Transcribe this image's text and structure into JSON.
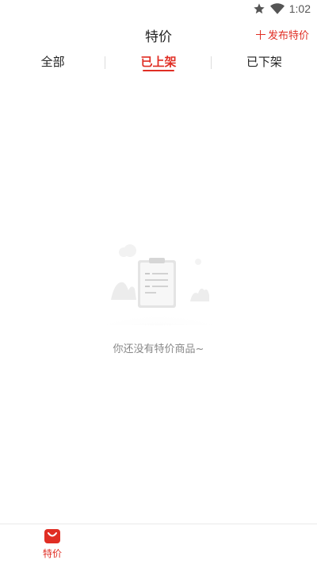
{
  "status_bar": {
    "time": "1:02",
    "icons": [
      "star-icon",
      "wifi-icon"
    ]
  },
  "header": {
    "title": "特价",
    "publish_label": "发布特价"
  },
  "tabs": [
    {
      "label": "全部",
      "active": false
    },
    {
      "label": "已上架",
      "active": true
    },
    {
      "label": "已下架",
      "active": false
    }
  ],
  "empty_state": {
    "message": "你还没有特价商品~"
  },
  "bottom_nav": {
    "items": [
      {
        "label": "特价",
        "icon": "shopping-bag-icon",
        "active": true
      }
    ]
  },
  "colors": {
    "accent": "#e02e24",
    "text": "#222222",
    "muted": "#888888"
  }
}
